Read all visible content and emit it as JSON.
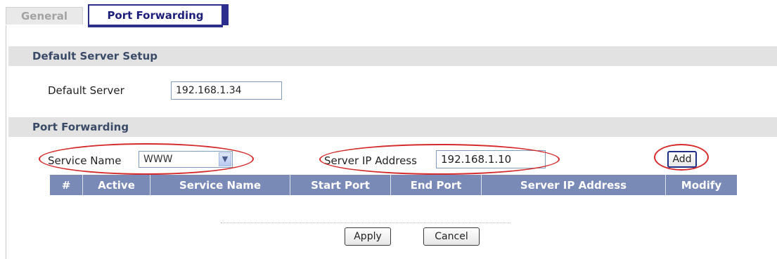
{
  "tabs": [
    {
      "label": "General"
    },
    {
      "label": "Port Forwarding"
    }
  ],
  "default_server_setup": {
    "title": "Default Server Setup",
    "default_server_label": "Default Server",
    "default_server_value": "192.168.1.34"
  },
  "port_forwarding": {
    "title": "Port Forwarding",
    "service_name_label": "Service Name",
    "service_name_selected": "WWW",
    "server_ip_label": "Server IP Address",
    "server_ip_value": "192.168.1.10",
    "add_label": "Add"
  },
  "table": {
    "columns": [
      "#",
      "Active",
      "Service Name",
      "Start Port",
      "End Port",
      "Server IP Address",
      "Modify"
    ]
  },
  "footer": {
    "apply_label": "Apply",
    "cancel_label": "Cancel"
  },
  "colors": {
    "tab_accent": "#2c2e8c",
    "table_header": "#7a8ab6",
    "section_header": "#e2e2e2",
    "annotation": "#d42a2a"
  },
  "icons": {
    "select_arrow": "chevron-down-icon"
  }
}
